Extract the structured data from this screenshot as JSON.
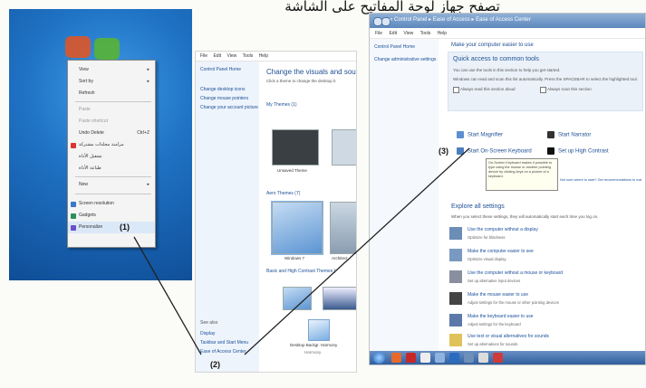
{
  "caption_arabic": "تصفح جهاز لوحة المفاتيح على الشاشة",
  "callouts": {
    "c1": "(1)",
    "c2": "(2)",
    "c3": "(3)"
  },
  "desktop_menu": {
    "items": [
      {
        "label": "View",
        "arrow": "▸"
      },
      {
        "label": "Sort by",
        "arrow": "▸"
      },
      {
        "label": "Refresh"
      },
      {
        "label": "Paste",
        "dim": true
      },
      {
        "label": "Paste shortcut",
        "dim": true
      },
      {
        "label": "Undo Delete",
        "shortcut": "Ctrl+Z"
      },
      {
        "label": "مزامنة مجلدات مشتركة"
      },
      {
        "label": "تشغيل الأداة"
      },
      {
        "label": "طباعة الأداة"
      },
      {
        "label": "New",
        "arrow": "▸"
      },
      {
        "label": "Screen resolution"
      },
      {
        "label": "Gadgets"
      },
      {
        "label": "Personalize"
      }
    ]
  },
  "personalization": {
    "menubar": [
      "File",
      "Edit",
      "View",
      "Tools",
      "Help"
    ],
    "side_links": [
      "Control Panel Home",
      "Change desktop icons",
      "Change mouse pointers",
      "Change your account picture"
    ],
    "title": "Change the visuals and sounds o",
    "subtitle": "Click a theme to change the desktop b",
    "section_my": "My Themes (1)",
    "section_aero": "Aero Themes (7)",
    "section_basic": "Basic and High Contrast Themes (",
    "theme_unsaved": "Unsaved Theme",
    "theme_windows7": "Windows 7",
    "theme_architecture": "Architect",
    "see_also": "See also",
    "side_bottom": [
      "Display",
      "Taskbar and Start Menu",
      "Ease of Access Center"
    ],
    "bottom_icon_label": "Desktop Backgr. Harmony",
    "bottom_icon_sub": "Harmony"
  },
  "ease_of_access": {
    "breadcrumb": "« Control Panel ▸ Ease of Access ▸ Ease of Access Center",
    "menubar": [
      "File",
      "Edit",
      "View",
      "Tools",
      "Help"
    ],
    "side_links": [
      "Control Panel Home",
      "Change administrative settings"
    ],
    "title": "Make your computer easier to use",
    "qa_heading": "Quick access to common tools",
    "qa_line1": "You can use the tools in this section to help you get started.",
    "qa_line2": "Windows can read and scan this list automatically.  Press the SPACEBAR to select the highlighted tool.",
    "qa_check1": "Always read this section aloud",
    "qa_check2": "Always scan this section",
    "tools": [
      {
        "label": "Start Magnifier",
        "icon": "magnifier-icon"
      },
      {
        "label": "Start Narrator",
        "icon": "narrator-icon"
      },
      {
        "label": "Start On-Screen Keyboard",
        "icon": "keyboard-icon"
      },
      {
        "label": "Set up High Contrast",
        "icon": "contrast-icon"
      }
    ],
    "tooltip": "On-Screen Keyboard makes it possible to type using the mouse or another pointing device by clicking keys on a picture of a keyboard.",
    "not_sure_link": "Not sure where to start? Get recommendations to make your computer easier to use",
    "explore_heading": "Explore all settings",
    "explore_sub": "When you select these settings, they will automatically start each time you log on.",
    "explore_items": [
      {
        "label": "Use the computer without a display",
        "desc": "Optimize for blindness"
      },
      {
        "label": "Make the computer easier to see",
        "desc": "Optimize visual display"
      },
      {
        "label": "Use the computer without a mouse or keyboard",
        "desc": "Set up alternative input devices"
      },
      {
        "label": "Make the mouse easier to use",
        "desc": "Adjust settings for the mouse or other pointing devices"
      },
      {
        "label": "Make the keyboard easier to use",
        "desc": "Adjust settings for the keyboard"
      },
      {
        "label": "Use text or visual alternatives for sounds",
        "desc": "Set up alternatives for sounds"
      }
    ]
  },
  "colors": {
    "accent": "#1e4f94",
    "link": "#1a4f99",
    "taskbar": "#2f5f9f"
  }
}
